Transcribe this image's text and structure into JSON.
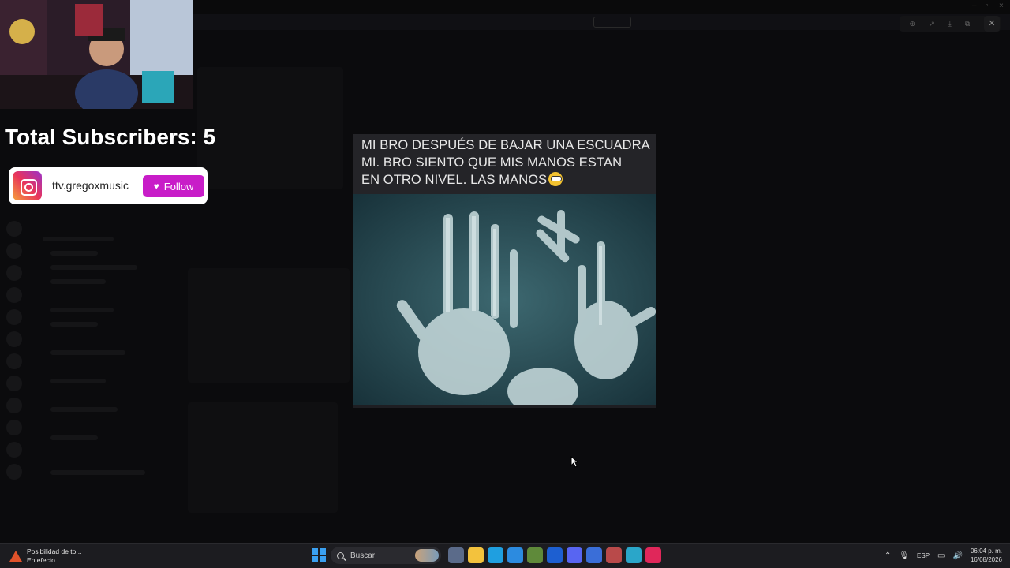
{
  "overlay": {
    "subscribers_text": "Total Subscribers: 5",
    "social_handle": "ttv.gregoxmusic",
    "follow_label": "Follow"
  },
  "meme": {
    "caption_lines": [
      "MI BRO DESPUÉS DE BAJAR UNA ESCUADRA",
      "MI.  BRO SIENTO QUE MIS MANOS ESTAN",
      "EN OTRO NIVEL. LAS MANOS"
    ]
  },
  "viewer_toolbar": {
    "icons": [
      "zoom-in-icon",
      "share-icon",
      "download-icon",
      "open-external-icon",
      "more-icon"
    ],
    "close_icon": "close-icon"
  },
  "taskbar": {
    "notification_title": "Posibilidad de to...",
    "notification_subtitle": "En efecto",
    "search_placeholder": "Buscar",
    "apps": [
      {
        "name": "task-view",
        "color": "#5b6b8a"
      },
      {
        "name": "file-explorer",
        "color": "#f3c23d"
      },
      {
        "name": "edge",
        "color": "#1f9fe0"
      },
      {
        "name": "store",
        "color": "#2c8be0"
      },
      {
        "name": "minecraft",
        "color": "#5f8a3a"
      },
      {
        "name": "app-blue",
        "color": "#1d5fd1"
      },
      {
        "name": "discord",
        "color": "#5865f2"
      },
      {
        "name": "app-diamond",
        "color": "#3a6ed8"
      },
      {
        "name": "app-gear",
        "color": "#b94a4a"
      },
      {
        "name": "app-f",
        "color": "#2aa6c9"
      },
      {
        "name": "tiktok",
        "color": "#e0275a"
      }
    ],
    "lang": "ESP",
    "time": "06:04 p. m.",
    "date": "16/08/2026"
  }
}
